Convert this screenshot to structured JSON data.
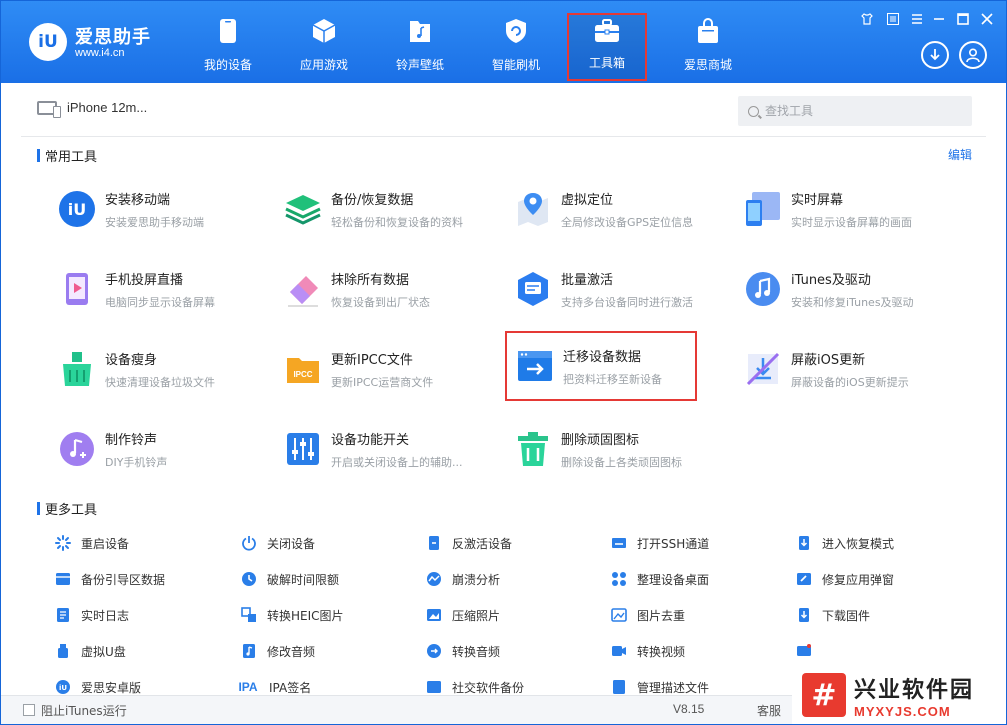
{
  "brand": {
    "logo_text": "iU",
    "name": "爱思助手",
    "url": "www.i4.cn"
  },
  "nav": [
    {
      "label": "我的设备",
      "icon": "phone-icon"
    },
    {
      "label": "应用游戏",
      "icon": "cube-icon"
    },
    {
      "label": "铃声壁纸",
      "icon": "music-file-icon"
    },
    {
      "label": "智能刷机",
      "icon": "refresh-shield-icon"
    },
    {
      "label": "工具箱",
      "icon": "toolbox-icon",
      "active": true
    },
    {
      "label": "爱思商城",
      "icon": "shopping-bag-icon"
    }
  ],
  "window_controls": [
    "shirt-icon",
    "menu-icon",
    "minimize-icon",
    "maximize-icon",
    "close-icon"
  ],
  "device": {
    "name": "iPhone 12m..."
  },
  "search": {
    "placeholder": "查找工具"
  },
  "common_section": {
    "title": "常用工具",
    "edit": "编辑"
  },
  "common_tools": [
    {
      "title": "安装移动端",
      "desc": "安装爱思助手移动端",
      "icon": "i4-mobile-icon"
    },
    {
      "title": "备份/恢复数据",
      "desc": "轻松备份和恢复设备的资料",
      "icon": "layers-backup-icon"
    },
    {
      "title": "虚拟定位",
      "desc": "全局修改设备GPS定位信息",
      "icon": "map-pin-icon"
    },
    {
      "title": "实时屏幕",
      "desc": "实时显示设备屏幕的画面",
      "icon": "screen-mirror-icon"
    },
    {
      "title": "手机投屏直播",
      "desc": "电脑同步显示设备屏幕",
      "icon": "phone-cast-icon"
    },
    {
      "title": "抹除所有数据",
      "desc": "恢复设备到出厂状态",
      "icon": "eraser-icon"
    },
    {
      "title": "批量激活",
      "desc": "支持多台设备同时进行激活",
      "icon": "batch-activate-icon"
    },
    {
      "title": "iTunes及驱动",
      "desc": "安装和修复iTunes及驱动",
      "icon": "itunes-icon"
    },
    {
      "title": "设备瘦身",
      "desc": "快速清理设备垃圾文件",
      "icon": "broom-icon"
    },
    {
      "title": "更新IPCC文件",
      "desc": "更新IPCC运营商文件",
      "icon": "ipcc-folder-icon"
    },
    {
      "title": "迁移设备数据",
      "desc": "把资料迁移至新设备",
      "icon": "migrate-data-icon",
      "highlight": true
    },
    {
      "title": "屏蔽iOS更新",
      "desc": "屏蔽设备的iOS更新提示",
      "icon": "block-update-icon"
    },
    {
      "title": "制作铃声",
      "desc": "DIY手机铃声",
      "icon": "ringtone-icon"
    },
    {
      "title": "设备功能开关",
      "desc": "开启或关闭设备上的辅助...",
      "icon": "toggle-switches-icon"
    },
    {
      "title": "删除顽固图标",
      "desc": "删除设备上各类顽固图标",
      "icon": "trash-icon"
    }
  ],
  "more_section": {
    "title": "更多工具"
  },
  "more_tools": [
    {
      "label": "重启设备",
      "icon": "restart-icon"
    },
    {
      "label": "关闭设备",
      "icon": "power-icon"
    },
    {
      "label": "反激活设备",
      "icon": "deactivate-icon"
    },
    {
      "label": "打开SSH通道",
      "icon": "ssh-icon"
    },
    {
      "label": "进入恢复模式",
      "icon": "recovery-mode-icon"
    },
    {
      "label": "备份引导区数据",
      "icon": "boot-backup-icon"
    },
    {
      "label": "破解时间限额",
      "icon": "clock-icon"
    },
    {
      "label": "崩溃分析",
      "icon": "crash-analysis-icon"
    },
    {
      "label": "整理设备桌面",
      "icon": "grid-desktop-icon"
    },
    {
      "label": "修复应用弹窗",
      "icon": "repair-popup-icon"
    },
    {
      "label": "实时日志",
      "icon": "log-icon"
    },
    {
      "label": "转换HEIC图片",
      "icon": "heic-convert-icon"
    },
    {
      "label": "压缩照片",
      "icon": "compress-photo-icon"
    },
    {
      "label": "图片去重",
      "icon": "dedupe-image-icon"
    },
    {
      "label": "下载固件",
      "icon": "download-firmware-icon"
    },
    {
      "label": "虚拟U盘",
      "icon": "usb-drive-icon"
    },
    {
      "label": "修改音频",
      "icon": "edit-audio-icon"
    },
    {
      "label": "转换音频",
      "icon": "convert-audio-icon"
    },
    {
      "label": "转换视频",
      "icon": "convert-video-icon"
    },
    {
      "label": "",
      "icon": "player-icon"
    },
    {
      "label": "爱思安卓版",
      "icon": "i4-android-icon"
    },
    {
      "label": "IPA签名",
      "icon": "ipa-sign-icon",
      "text_icon": "IPA"
    },
    {
      "label": "社交软件备份",
      "icon": "social-backup-icon"
    },
    {
      "label": "管理描述文件",
      "icon": "profile-icon"
    },
    {
      "label": "",
      "icon": ""
    }
  ],
  "footer": {
    "checkbox_label": "阻止iTunes运行",
    "version": "V8.15",
    "service": "客服"
  },
  "watermark": {
    "logo": "#",
    "cn": "兴业软件园",
    "en": "MYXYJS.COM"
  },
  "colors": {
    "header": "#1a6fe6",
    "accent": "#1e73e8",
    "highlight": "#e53935"
  }
}
